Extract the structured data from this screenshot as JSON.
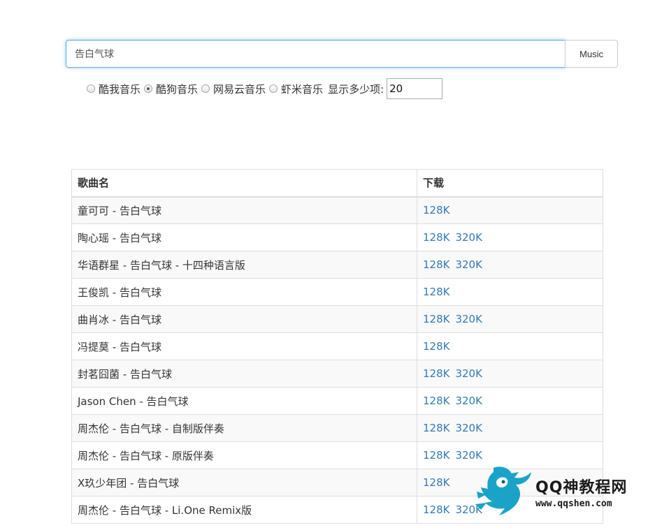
{
  "search": {
    "value": "告白气球",
    "button_label": "Music"
  },
  "sources": [
    {
      "label": "酷我音乐",
      "checked": false
    },
    {
      "label": "酷狗音乐",
      "checked": true
    },
    {
      "label": "网易云音乐",
      "checked": false
    },
    {
      "label": "虾米音乐",
      "checked": false
    }
  ],
  "count": {
    "label": "显示多少项:",
    "value": "20"
  },
  "table": {
    "headers": [
      "歌曲名",
      "下载"
    ],
    "rows": [
      {
        "name": "童可可 - 告白气球",
        "links": [
          "128K"
        ]
      },
      {
        "name": "陶心瑶 - 告白气球",
        "links": [
          "128K",
          "320K"
        ]
      },
      {
        "name": "华语群星 - 告白气球 - 十四种语言版",
        "links": [
          "128K",
          "320K"
        ]
      },
      {
        "name": "王俊凯 - 告白气球",
        "links": [
          "128K"
        ]
      },
      {
        "name": "曲肖冰 - 告白气球",
        "links": [
          "128K",
          "320K"
        ]
      },
      {
        "name": "冯提莫 - 告白气球",
        "links": [
          "128K"
        ]
      },
      {
        "name": "封茗囧菌 - 告白气球",
        "links": [
          "128K",
          "320K"
        ]
      },
      {
        "name": "Jason Chen - 告白气球",
        "links": [
          "128K",
          "320K"
        ]
      },
      {
        "name": "周杰伦 - 告白气球 - 自制版伴奏",
        "links": [
          "128K",
          "320K"
        ]
      },
      {
        "name": "周杰伦 - 告白气球 - 原版伴奏",
        "links": [
          "128K",
          "320K"
        ]
      },
      {
        "name": "X玖少年团 - 告白气球",
        "links": [
          "128K"
        ]
      },
      {
        "name": "周杰伦 - 告白气球 - Li.One Remix版",
        "links": [
          "128K",
          "320K"
        ]
      }
    ]
  },
  "watermark": {
    "title": "QQ神教程网",
    "url": "www.qqshen.com",
    "icon": "dragon-logo-icon",
    "color": "#1aa3c7"
  },
  "colors": {
    "link": "#337ab7",
    "focus_border": "#66afe9",
    "row_stripe": "#f9f9f9",
    "border": "#dddddd"
  }
}
